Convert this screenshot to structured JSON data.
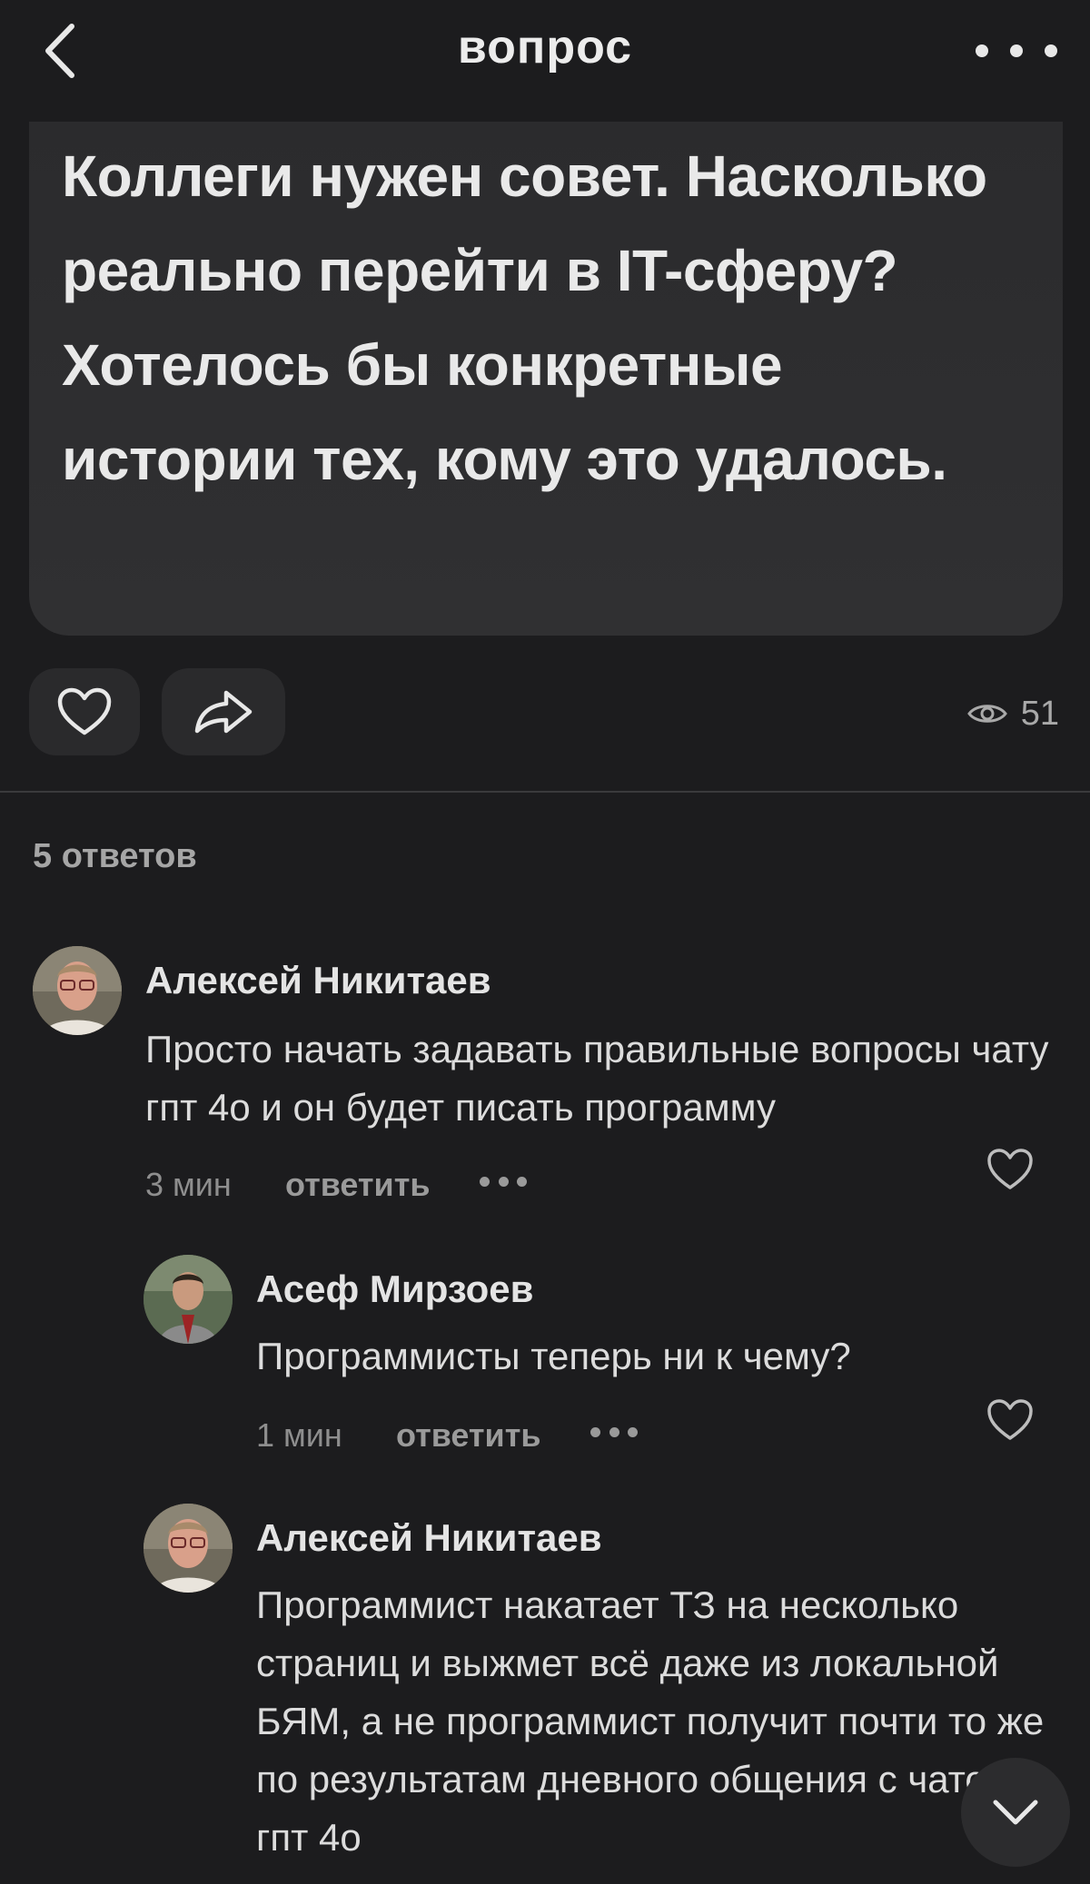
{
  "header": {
    "title": "вопрос",
    "back_icon": "chevron-left-icon",
    "more_icon": "more-horizontal-icon"
  },
  "question": {
    "text": "Коллеги нужен совет. Насколько реально перейти в IT-сферу? Хотелось бы конкретные истории тех, кому это удалось."
  },
  "actions": {
    "like_icon": "heart-icon",
    "share_icon": "share-icon",
    "views_icon": "eye-icon",
    "views_count": "51"
  },
  "answers": {
    "count_label": "5 ответов",
    "items": [
      {
        "author": "Алексей Никитаев",
        "text": "Просто начать задавать правильные вопросы чату гпт 4о и он будет писать программу",
        "time": "3 мин",
        "reply_label": "ответить"
      },
      {
        "author": "Асеф Мирзоев",
        "text": "Программисты теперь ни к чему?",
        "time": "1 мин",
        "reply_label": "ответить"
      },
      {
        "author": "Алексей Никитаев",
        "text": "Программист накатает ТЗ на несколько страниц и выжмет всё даже из локальной БЯМ, а не программист получит почти то же по результатам дневного общения с чатом гпт 4о"
      }
    ]
  },
  "colors": {
    "background": "#1c1c1e",
    "card": "#2b2b2d",
    "text": "#e6e6e6",
    "muted": "#8e8e8e"
  }
}
